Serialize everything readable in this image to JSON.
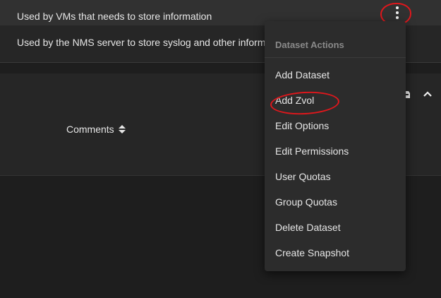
{
  "table": {
    "row1_comment": "Used by VMs that needs to store information",
    "row2_comment": "Used by the NMS server to store syslog and other inform",
    "comments_header": "Comments"
  },
  "menu": {
    "header": "Dataset Actions",
    "items": [
      "Add Dataset",
      "Add Zvol",
      "Edit Options",
      "Edit Permissions",
      "User Quotas",
      "Group Quotas",
      "Delete Dataset",
      "Create Snapshot"
    ]
  },
  "icons": {
    "kebab": "more-vert-icon",
    "sort": "sort-icon",
    "collapse": "chevron-up-icon"
  },
  "colors": {
    "annotation": "#e0171c",
    "menu_bg": "#2c2c2c",
    "row_highlight": "#313131"
  }
}
